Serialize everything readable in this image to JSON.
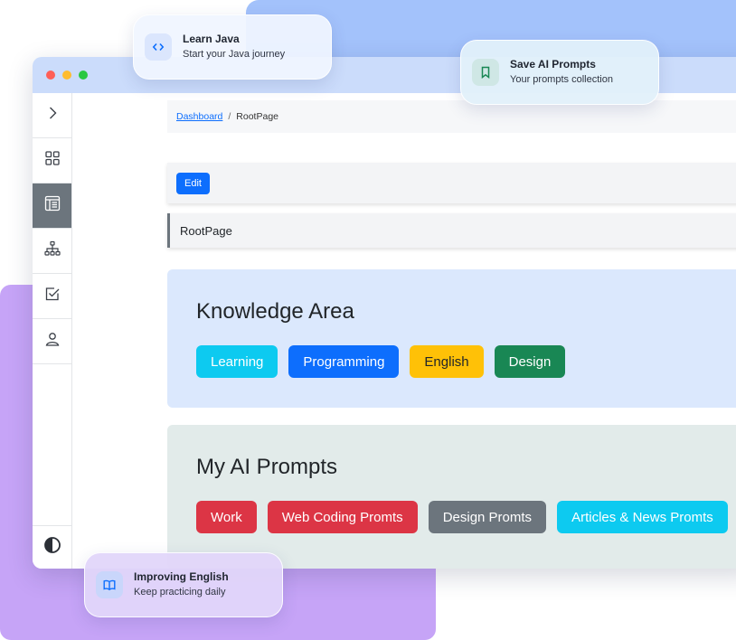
{
  "floating_cards": {
    "java": {
      "title": "Learn Java",
      "subtitle": "Start your Java journey",
      "icon": "code-icon",
      "icon_color": "#0d6efd"
    },
    "save": {
      "title": "Save AI Prompts",
      "subtitle": "Your prompts collection",
      "icon": "bookmark-icon",
      "icon_color": "#198754"
    },
    "english": {
      "title": "Improving English",
      "subtitle": "Keep practicing daily",
      "icon": "book-open-icon",
      "icon_color": "#0d6efd"
    }
  },
  "sidebar": {
    "items": [
      {
        "name": "expand",
        "icon": "chevron-right-icon"
      },
      {
        "name": "dashboard",
        "icon": "grid-icon"
      },
      {
        "name": "pages",
        "icon": "layout-icon",
        "active": true
      },
      {
        "name": "sitemap",
        "icon": "sitemap-icon"
      },
      {
        "name": "tasks",
        "icon": "checkbox-icon"
      },
      {
        "name": "profile",
        "icon": "user-icon"
      }
    ],
    "bottom_icon": "theme-toggle-icon"
  },
  "breadcrumb": {
    "link": "Dashboard",
    "separator": "/",
    "current": "RootPage"
  },
  "toolbar": {
    "edit_label": "Edit"
  },
  "page": {
    "title": "RootPage"
  },
  "knowledge": {
    "title": "Knowledge Area",
    "tags": [
      {
        "label": "Learning",
        "bg": "#0dcaf0",
        "fg": "#ffffff"
      },
      {
        "label": "Programming",
        "bg": "#0d6efd",
        "fg": "#ffffff"
      },
      {
        "label": "English",
        "bg": "#ffc107",
        "fg": "#212529"
      },
      {
        "label": "Design",
        "bg": "#198754",
        "fg": "#ffffff"
      }
    ]
  },
  "prompts": {
    "title": "My AI Prompts",
    "tags": [
      {
        "label": "Work",
        "bg": "#dc3545",
        "fg": "#ffffff"
      },
      {
        "label": "Web Coding Promts",
        "bg": "#dc3545",
        "fg": "#ffffff"
      },
      {
        "label": "Design Promts",
        "bg": "#6c757d",
        "fg": "#ffffff"
      },
      {
        "label": "Articles & News Promts",
        "bg": "#0dcaf0",
        "fg": "#ffffff"
      }
    ]
  },
  "colors": {
    "accent": "#0d6efd",
    "sidebar_active": "#6c757d"
  }
}
